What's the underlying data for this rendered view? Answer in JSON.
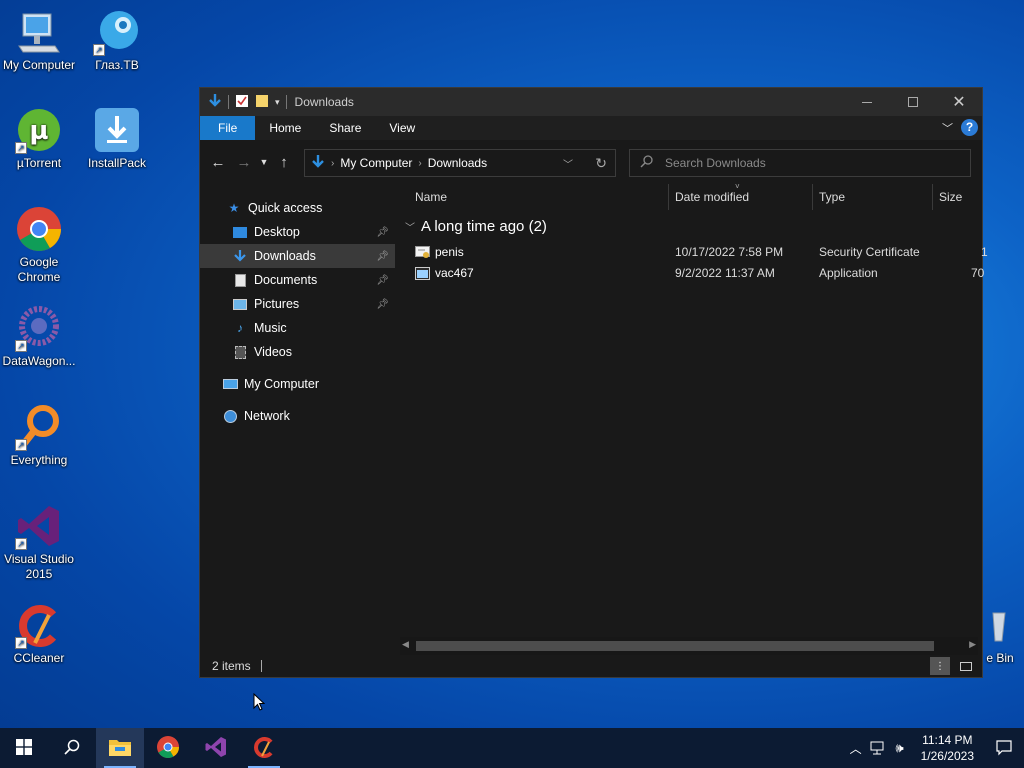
{
  "desktop": {
    "icons": [
      {
        "label": "My Computer",
        "icon": "computer-icon"
      },
      {
        "label": "Глаз.TB",
        "icon": "glaz-tv-icon"
      },
      {
        "label": "µTorrent",
        "icon": "utorrent-icon"
      },
      {
        "label": "InstallPack",
        "icon": "installpack-icon"
      },
      {
        "label": "Google Chrome",
        "icon": "chrome-icon"
      },
      {
        "label": "DataWagon...",
        "icon": "datawagon-icon"
      },
      {
        "label": "Everything",
        "icon": "everything-icon"
      },
      {
        "label": "Visual Studio 2015",
        "icon": "visual-studio-icon"
      },
      {
        "label": "CCleaner",
        "icon": "ccleaner-icon"
      },
      {
        "label": "e Bin",
        "icon": "recycle-bin-icon"
      }
    ]
  },
  "window": {
    "title": "Downloads",
    "ribbon_tabs": [
      "File",
      "Home",
      "Share",
      "View"
    ],
    "address": {
      "root": "My Computer",
      "current": "Downloads"
    },
    "search_placeholder": "Search Downloads",
    "nav": {
      "quick_access": "Quick access",
      "items": [
        {
          "label": "Desktop",
          "pinned": true
        },
        {
          "label": "Downloads",
          "pinned": true
        },
        {
          "label": "Documents",
          "pinned": true
        },
        {
          "label": "Pictures",
          "pinned": true
        },
        {
          "label": "Music",
          "pinned": false
        },
        {
          "label": "Videos",
          "pinned": false
        }
      ],
      "my_computer": "My Computer",
      "network": "Network"
    },
    "columns": [
      "Name",
      "Date modified",
      "Type",
      "Size"
    ],
    "group_label": "A long time ago (2)",
    "files": [
      {
        "name": "penis",
        "date": "10/17/2022 7:58 PM",
        "type": "Security Certificate",
        "size": "1"
      },
      {
        "name": "vac467",
        "date": "9/2/2022 11:37 AM",
        "type": "Application",
        "size": "70"
      }
    ],
    "status": "2 items"
  },
  "taskbar": {
    "time": "11:14 PM",
    "date": "1/26/2023"
  },
  "colors": {
    "accent": "#1979ca",
    "window_bg": "#191919",
    "taskbar_bg": "#0c1b33"
  }
}
